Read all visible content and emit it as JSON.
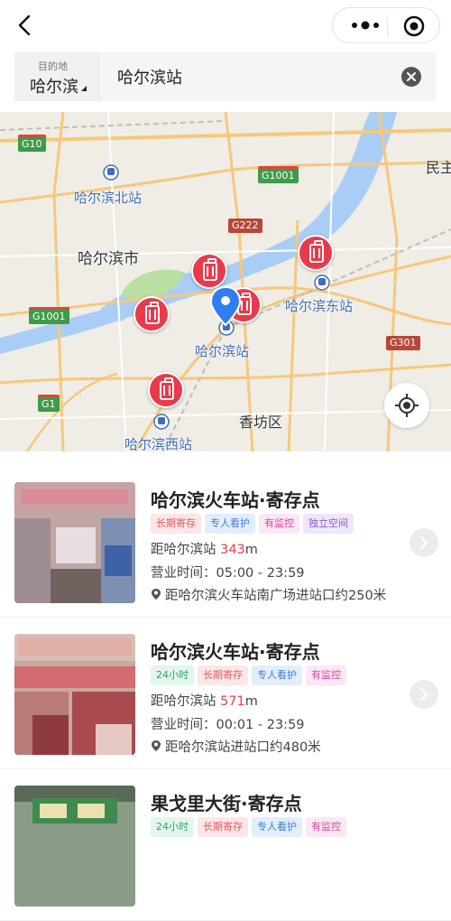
{
  "colors": {
    "accent_red": "#e93a4c",
    "station_blue": "#3f6dba",
    "distance_red": "#e8434f"
  },
  "searchbar": {
    "dest_label": "目的地",
    "dest_city": "哈尔滨",
    "query": "哈尔滨站"
  },
  "map": {
    "labels": {
      "harbin_north": "哈尔滨北站",
      "harbin_city": "哈尔滨市",
      "harbin_east": "哈尔滨东站",
      "harbin_station": "哈尔滨站",
      "xiangfang": "香坊区",
      "harbin_west": "哈尔滨西站",
      "minzhu": "民主"
    },
    "shields": {
      "g10": "G10",
      "g1001a": "G1001",
      "g222": "G222",
      "g1001b": "G1001",
      "g301": "G301",
      "g1": "G1"
    }
  },
  "listings": [
    {
      "title": "哈尔滨火车站·寄存点",
      "tags": [
        {
          "text": "长期寄存",
          "style": "red"
        },
        {
          "text": "专人看护",
          "style": "blue"
        },
        {
          "text": "有监控",
          "style": "pink"
        },
        {
          "text": "独立空间",
          "style": "purple"
        }
      ],
      "distance_prefix": "距哈尔滨站 ",
      "distance_value": "343",
      "distance_unit": "m",
      "hours": "营业时间：05:00 - 23:59",
      "address": "距哈尔滨火车站南广场进站口约250米"
    },
    {
      "title": "哈尔滨火车站·寄存点",
      "tags": [
        {
          "text": "24小时",
          "style": "green"
        },
        {
          "text": "长期寄存",
          "style": "red"
        },
        {
          "text": "专人看护",
          "style": "blue"
        },
        {
          "text": "有监控",
          "style": "pink"
        }
      ],
      "distance_prefix": "距哈尔滨站 ",
      "distance_value": "571",
      "distance_unit": "m",
      "hours": "营业时间：00:01 - 23:59",
      "address": "距哈尔滨站进站口约480米"
    },
    {
      "title": "果戈里大街·寄存点",
      "tags": [
        {
          "text": "24小时",
          "style": "green"
        },
        {
          "text": "长期寄存",
          "style": "red"
        },
        {
          "text": "专人看护",
          "style": "blue"
        },
        {
          "text": "有监控",
          "style": "pink"
        }
      ]
    }
  ]
}
